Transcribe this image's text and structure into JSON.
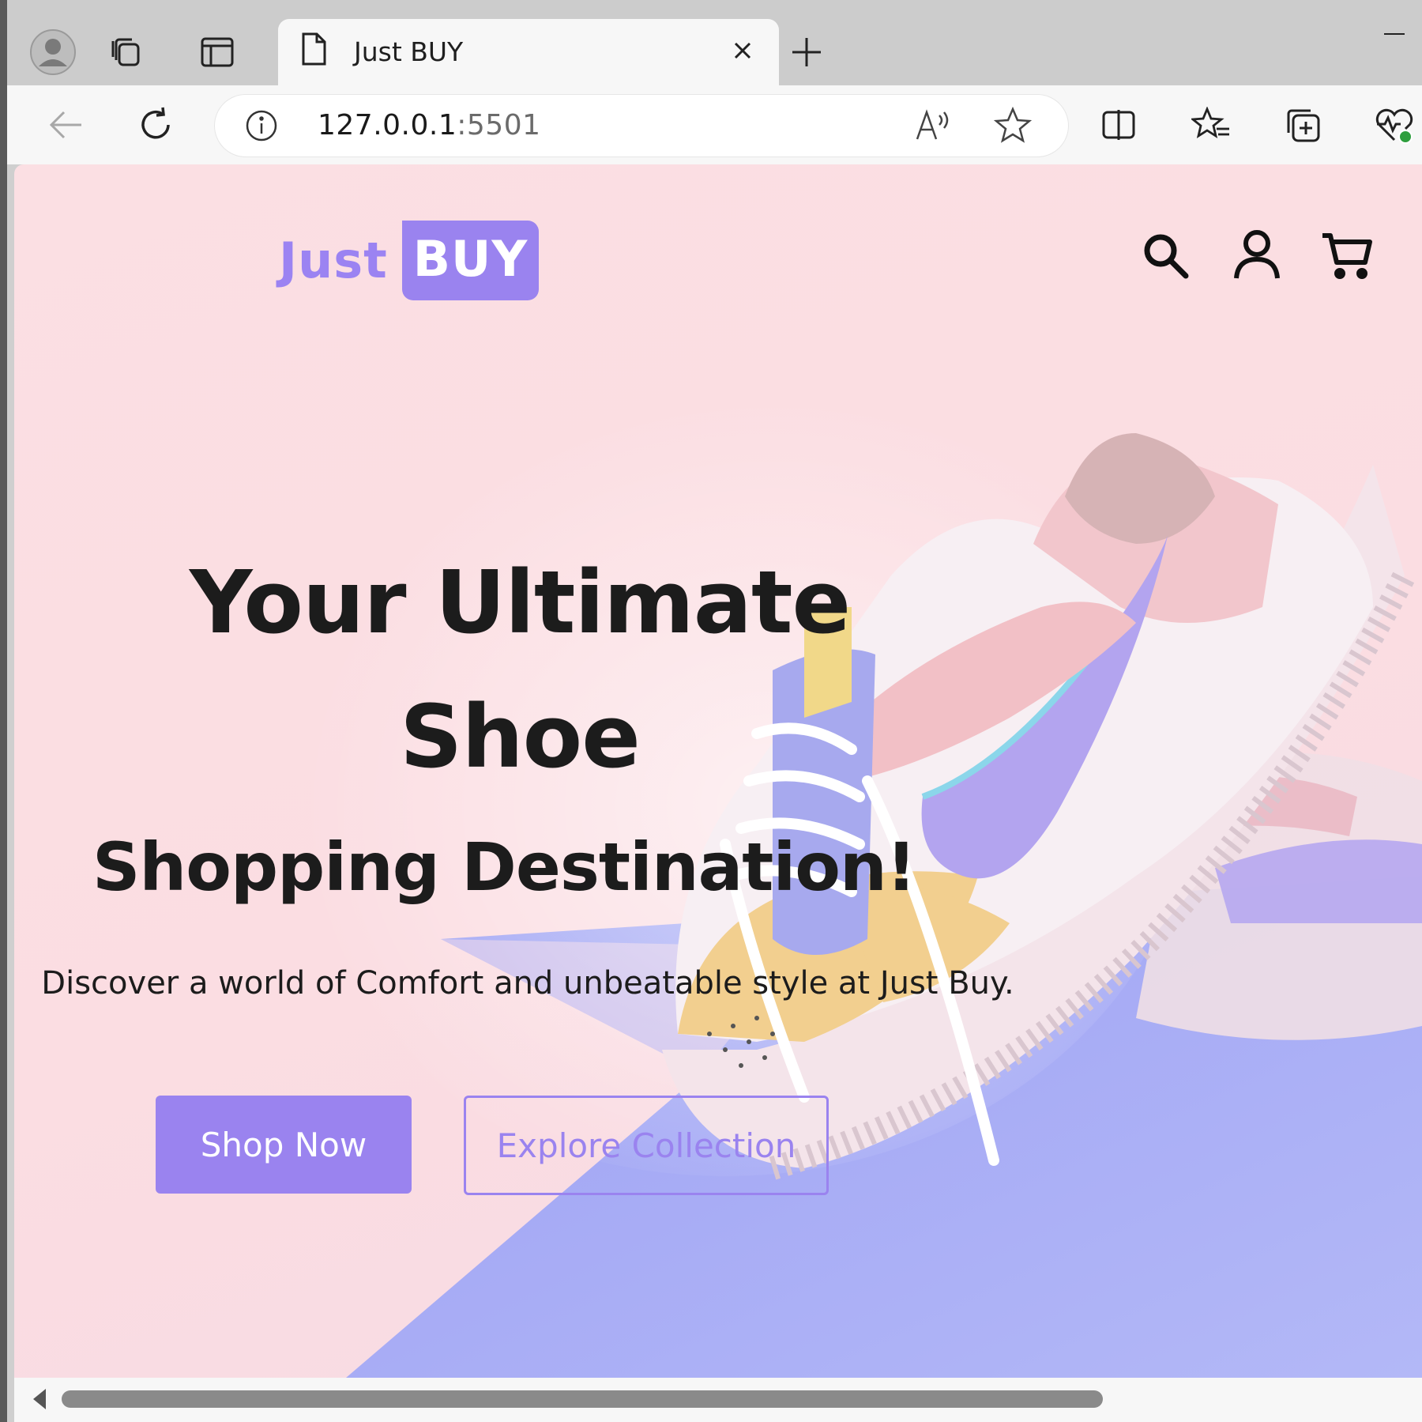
{
  "browser": {
    "tab_title": "Just BUY",
    "url_host": "127.0.0.1",
    "url_port": ":5501"
  },
  "site": {
    "logo_just": "Just",
    "logo_buy": "BUY",
    "hero_line1": "Your Ultimate",
    "hero_line2": "Shoe",
    "hero_line3": "Shopping Destination!",
    "description": "Discover a world of Comfort and unbeatable style at Just Buy.",
    "shop_button": "Shop Now",
    "explore_button": "Explore Collection"
  },
  "colors": {
    "accent": "#9a83ef",
    "hero_bg": "#fbdfe3",
    "floor": "#8f95ee"
  },
  "icons": [
    "profile-icon",
    "workspaces-icon",
    "vertical-tabs-icon",
    "page-icon",
    "close-icon",
    "new-tab-icon",
    "back-icon",
    "refresh-icon",
    "info-icon",
    "read-aloud-icon",
    "favorite-star-icon",
    "split-screen-icon",
    "favorites-icon",
    "collections-icon",
    "browser-essentials-icon",
    "search-icon",
    "user-icon",
    "cart-icon"
  ]
}
